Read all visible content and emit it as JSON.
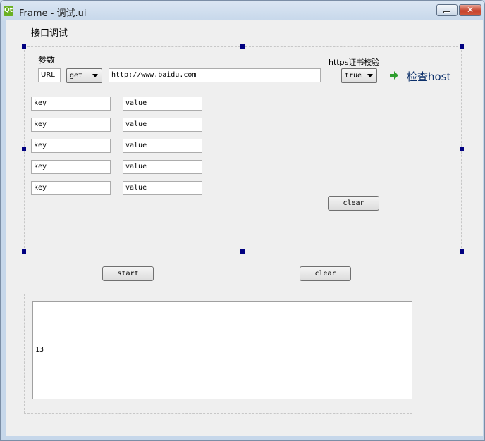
{
  "window": {
    "icon_text": "Qt",
    "title": "Frame - 调试.ui",
    "close_glyph": "✕"
  },
  "form": {
    "section_title": "接口调试",
    "params_label": "参数",
    "url_label": "URL",
    "method": "get",
    "url_value": "http://www.baidu.com",
    "https_label": "https证书校验",
    "https_value": "true",
    "check_host_label": "检查host",
    "param_rows": [
      {
        "key": "key",
        "value": "value"
      },
      {
        "key": "key",
        "value": "value"
      },
      {
        "key": "key",
        "value": "value"
      },
      {
        "key": "key",
        "value": "value"
      },
      {
        "key": "key",
        "value": "value"
      }
    ],
    "clear_params_label": "clear"
  },
  "actions": {
    "start_label": "start",
    "clear_label": "clear"
  },
  "output": {
    "text": "13"
  },
  "colors": {
    "handle": "#000080",
    "arrow": "#2e9e2e",
    "host_text": "#0b2f6a"
  }
}
